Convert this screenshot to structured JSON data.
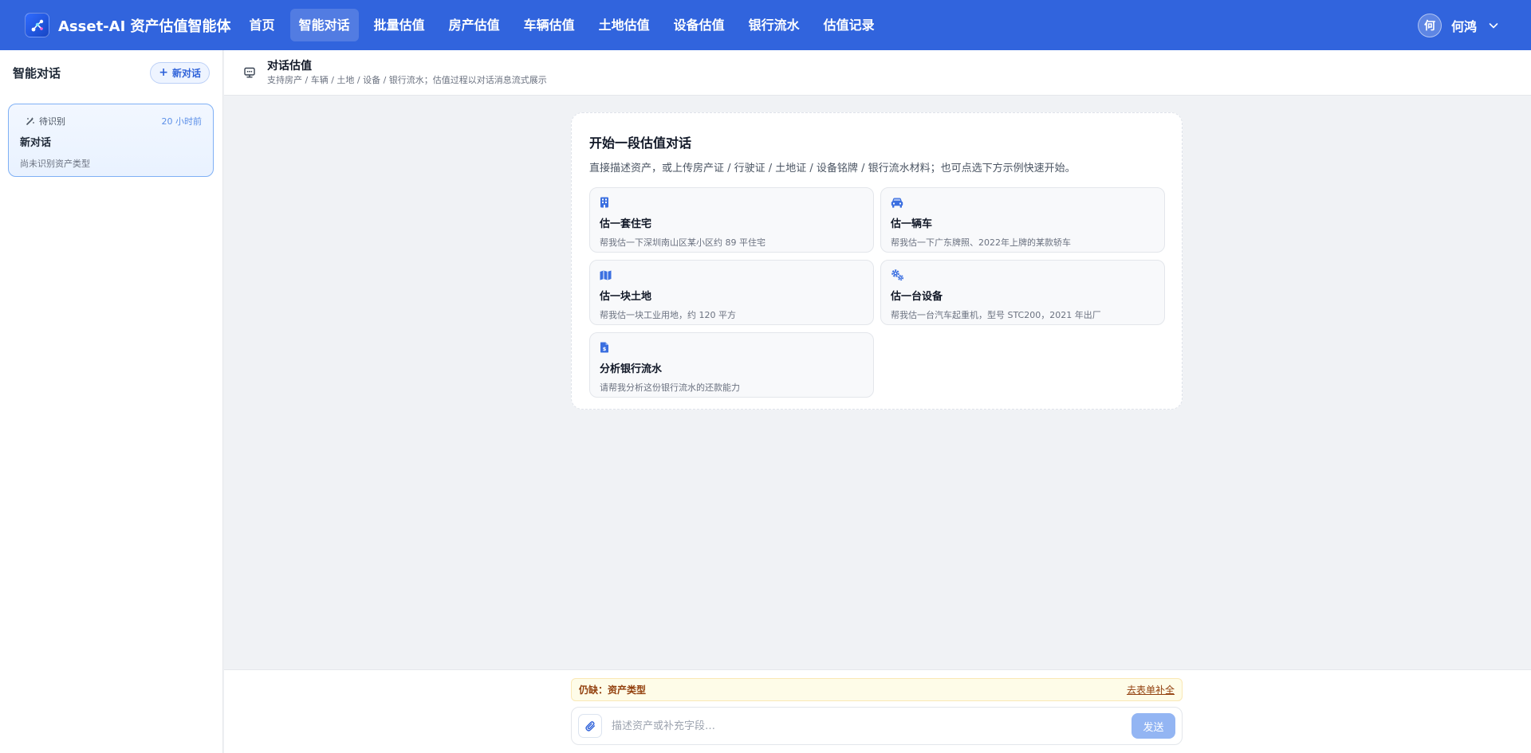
{
  "app": {
    "brand_name": "Asset-AI 资产估值智能体",
    "logo_icon": "network-nodes-icon"
  },
  "nav": {
    "items": [
      {
        "label": "首页",
        "active": false
      },
      {
        "label": "智能对话",
        "active": true
      },
      {
        "label": "批量估值",
        "active": false
      },
      {
        "label": "房产估值",
        "active": false
      },
      {
        "label": "车辆估值",
        "active": false
      },
      {
        "label": "土地估值",
        "active": false
      },
      {
        "label": "设备估值",
        "active": false
      },
      {
        "label": "银行流水",
        "active": false
      },
      {
        "label": "估值记录",
        "active": false
      }
    ]
  },
  "user": {
    "avatar_text": "何",
    "name": "何鸿"
  },
  "sidebar": {
    "title": "智能对话",
    "new_chat_label": "新对话",
    "conversations": [
      {
        "status": "待识别",
        "time": "20 小时前",
        "title": "新对话",
        "subtitle": "尚未识别资产类型"
      }
    ]
  },
  "header": {
    "title": "对话估值",
    "subtitle": "支持房产 / 车辆 / 土地 / 设备 / 银行流水；估值过程以对话消息流式展示"
  },
  "start": {
    "title": "开始一段估值对话",
    "description": "直接描述资产，或上传房产证 / 行驶证 / 土地证 / 设备铭牌 / 银行流水材料；也可点选下方示例快速开始。",
    "examples": [
      {
        "icon": "building-icon",
        "title": "估一套住宅",
        "desc": "帮我估一下深圳南山区某小区约 89 平住宅"
      },
      {
        "icon": "car-icon",
        "title": "估一辆车",
        "desc": "帮我估一下广东牌照、2022年上牌的某款轿车"
      },
      {
        "icon": "map-icon",
        "title": "估一块土地",
        "desc": "帮我估一块工业用地，约 120 平方"
      },
      {
        "icon": "gears-icon",
        "title": "估一台设备",
        "desc": "帮我估一台汽车起重机，型号 STC200，2021 年出厂"
      },
      {
        "icon": "invoice-icon",
        "title": "分析银行流水",
        "desc": "请帮我分析这份银行流水的还款能力"
      }
    ]
  },
  "composer": {
    "missing_text": "仍缺：资产类型",
    "fill_link": "去表单补全",
    "placeholder": "描述资产或补充字段…",
    "send_label": "发送"
  },
  "colors": {
    "topbar": "#3164dd",
    "accent": "#2f62d9",
    "send_disabled": "#93b5f3"
  }
}
